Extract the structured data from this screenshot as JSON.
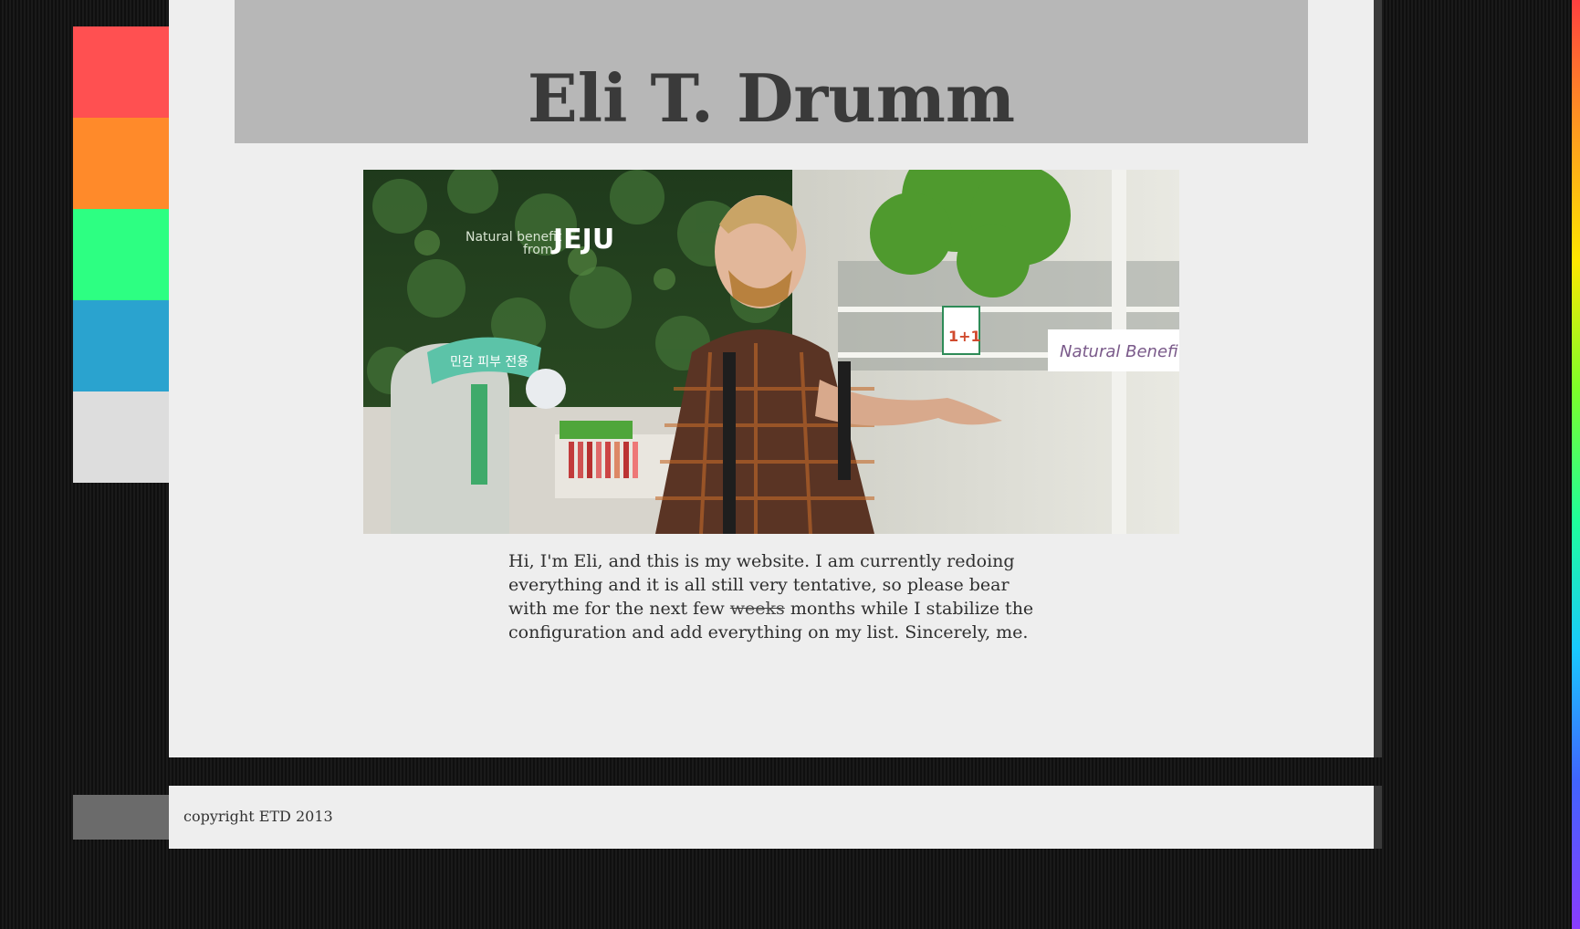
{
  "site": {
    "title": "Eli T. Drumm"
  },
  "nav": {
    "items": [
      {
        "color": "#ff5051",
        "icon": "color-tab"
      },
      {
        "color": "#ff8a2a",
        "icon": "color-tab"
      },
      {
        "color": "#2dff82",
        "icon": "color-tab"
      },
      {
        "color": "#2aa3cf",
        "icon": "color-tab"
      },
      {
        "color": "#dddddd",
        "icon": "color-tab"
      }
    ]
  },
  "hero": {
    "sign_text_1": "Natural benefit",
    "sign_text_2": "from",
    "sign_brand": "JEJU",
    "sign_right": "Natural Benefit",
    "korean_sign": "민감 피부 전용",
    "price_tag": "1+1"
  },
  "intro": {
    "before_strike": "Hi, I'm Eli, and this is my website. I am currently redoing everything and it is all still very tentative, so please bear with me for the next few ",
    "struck": "weeks",
    "after_strike": " months while I stabilize the configuration and add everything on my list. Sincerely, me."
  },
  "footer": {
    "copyright": "copyright ETD 2013"
  },
  "colors": {
    "background": "#121212",
    "panel": "#eeeeee",
    "header": "#b7b7b7",
    "title": "#3a3a3a"
  }
}
